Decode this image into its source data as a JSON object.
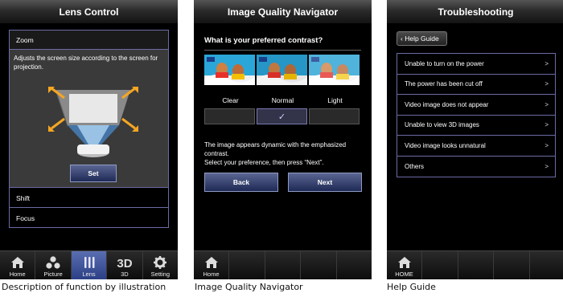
{
  "panel1": {
    "title": "Lens Control",
    "zoom_label": "Zoom",
    "description": "Adjusts the screen size according to the screen for projection.",
    "set_label": "Set",
    "shift_label": "Shift",
    "focus_label": "Focus",
    "nav": [
      {
        "label": "Home",
        "icon": "home-icon"
      },
      {
        "label": "Picture",
        "icon": "picture-icon"
      },
      {
        "label": "Lens",
        "icon": "lens-icon",
        "active": true
      },
      {
        "label": "3D",
        "icon": "3d-icon"
      },
      {
        "label": "Setting",
        "icon": "gear-icon"
      }
    ],
    "caption": "Description of function by illustration"
  },
  "panel2": {
    "title": "Image Quality Navigator",
    "question": "What is your preferred contrast?",
    "options": [
      "Clear",
      "Normal",
      "Light"
    ],
    "selected_option": "Normal",
    "selected_mark": "✓",
    "instruction": "The image appears dynamic with the emphasized contrast. Select your preference, then press “Next”.",
    "instruction_line1": "The image appears dynamic with the emphasized contrast.",
    "instruction_line2": "Select your preference, then press “Next”.",
    "back_label": "Back",
    "next_label": "Next",
    "nav": [
      {
        "label": "Home",
        "icon": "home-icon"
      }
    ],
    "caption": "Image Quality Navigator"
  },
  "panel3": {
    "title": "Troubleshooting",
    "help_guide_label": "Help Guide",
    "items": [
      "Unable to turn on the power",
      "The power has been cut off",
      "Video image does not appear",
      "Unable to view 3D images",
      "Video image looks unnatural",
      "Others"
    ],
    "item_arrow": ">",
    "nav": [
      {
        "label": "HOME",
        "icon": "home-icon"
      }
    ],
    "caption": "Help Guide"
  },
  "colors": {
    "border_accent": "#6b6ba5",
    "active_tab": "#3f52a0",
    "button": "#2e3a66"
  }
}
